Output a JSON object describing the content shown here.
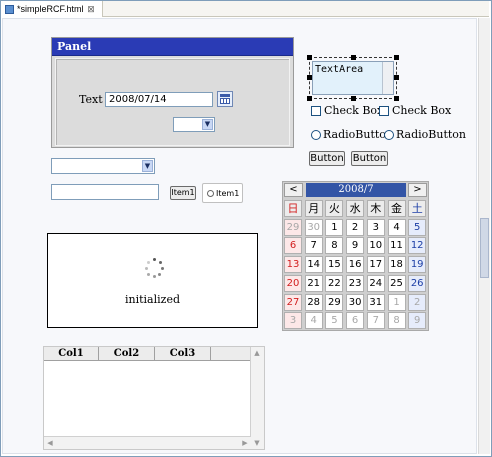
{
  "editor": {
    "tab_title": "*simpleRCF.html",
    "close_glyph": "⊠"
  },
  "panel": {
    "title": "Panel",
    "text_label": "Text",
    "date_value": "2008/07/14"
  },
  "textarea": {
    "value": "TextArea"
  },
  "checkboxes": [
    {
      "label": "Check Box",
      "checked": false
    },
    {
      "label": "Check Box",
      "checked": false
    }
  ],
  "radios": [
    {
      "label": "RadioButton",
      "selected": false
    },
    {
      "label": "RadioButton",
      "selected": false
    }
  ],
  "buttons": [
    "Button",
    "Button"
  ],
  "listbox_buttons": {
    "item_button": "Item1",
    "item_radio": "Item1"
  },
  "calendar": {
    "month_title": "2008/7",
    "prev": "<",
    "next": ">",
    "weekdays": [
      "日",
      "月",
      "火",
      "水",
      "木",
      "金",
      "土"
    ],
    "weeks": [
      [
        "29",
        "30",
        "1",
        "2",
        "3",
        "4",
        "5"
      ],
      [
        "6",
        "7",
        "8",
        "9",
        "10",
        "11",
        "12"
      ],
      [
        "13",
        "14",
        "15",
        "16",
        "17",
        "18",
        "19"
      ],
      [
        "20",
        "21",
        "22",
        "23",
        "24",
        "25",
        "26"
      ],
      [
        "27",
        "28",
        "29",
        "30",
        "31",
        "1",
        "2"
      ],
      [
        "3",
        "4",
        "5",
        "6",
        "7",
        "8",
        "9"
      ]
    ],
    "other_month": [
      [
        true,
        true,
        false,
        false,
        false,
        false,
        false
      ],
      [
        false,
        false,
        false,
        false,
        false,
        false,
        false
      ],
      [
        false,
        false,
        false,
        false,
        false,
        false,
        false
      ],
      [
        false,
        false,
        false,
        false,
        false,
        false,
        false
      ],
      [
        false,
        false,
        false,
        false,
        false,
        true,
        true
      ],
      [
        true,
        true,
        true,
        true,
        true,
        true,
        true
      ]
    ],
    "colors": {
      "sunday": "#d21e1e",
      "saturday": "#1c3ea6",
      "header": "#3355a6"
    }
  },
  "loader": {
    "status": "initialized"
  },
  "table": {
    "columns": [
      "Col1",
      "Col2",
      "Col3"
    ]
  },
  "colors": {
    "panel_header": "#2a3bb5",
    "selection_fill": "#e2f1fb"
  }
}
